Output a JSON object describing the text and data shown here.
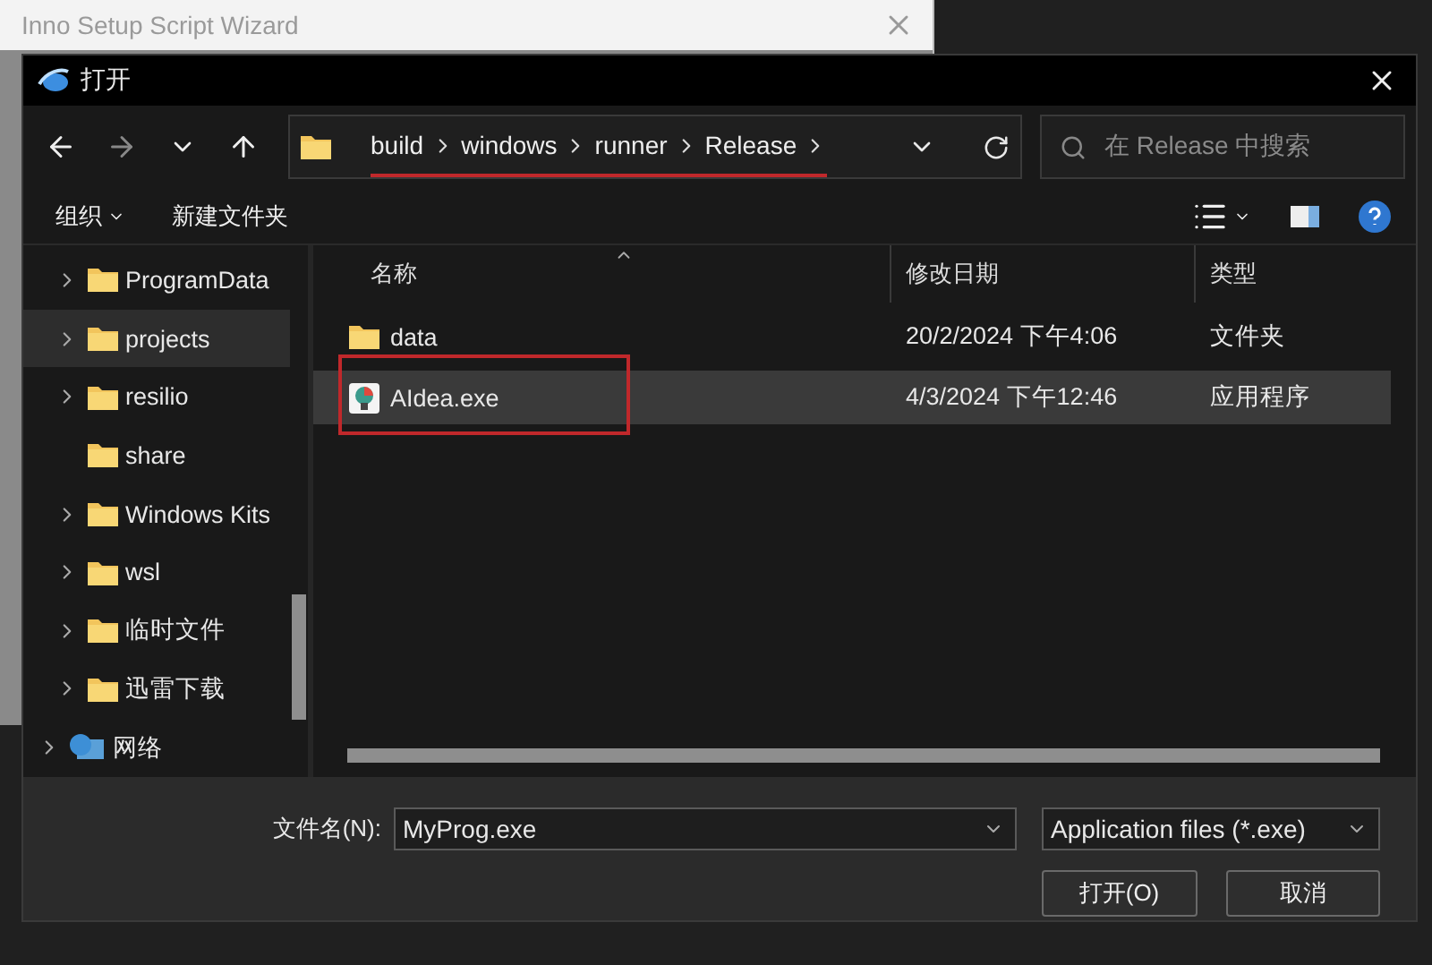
{
  "background_window": {
    "title": "Inno Setup Script Wizard"
  },
  "dialog": {
    "title": "打开"
  },
  "address": {
    "crumbs": [
      "build",
      "windows",
      "runner",
      "Release"
    ],
    "underlined": true
  },
  "search": {
    "placeholder": "在 Release 中搜索"
  },
  "commands": [
    {
      "label": "组织",
      "dropdown": true
    },
    {
      "label": "新建文件夹",
      "dropdown": false
    }
  ],
  "sidebar": {
    "items": [
      {
        "label": "ProgramData",
        "kind": "folder",
        "expandable": true,
        "selected": false
      },
      {
        "label": "projects",
        "kind": "folder",
        "expandable": true,
        "selected": true
      },
      {
        "label": "resilio",
        "kind": "folder",
        "expandable": true,
        "selected": false
      },
      {
        "label": "share",
        "kind": "folder",
        "expandable": false,
        "selected": false
      },
      {
        "label": "Windows Kits",
        "kind": "folder",
        "expandable": true,
        "selected": false
      },
      {
        "label": "wsl",
        "kind": "folder",
        "expandable": true,
        "selected": false
      },
      {
        "label": "临时文件",
        "kind": "folder",
        "expandable": true,
        "selected": false
      },
      {
        "label": "迅雷下载",
        "kind": "folder",
        "expandable": true,
        "selected": false
      },
      {
        "label": "网络",
        "kind": "network",
        "expandable": true,
        "selected": false
      }
    ]
  },
  "table": {
    "columns": [
      "名称",
      "修改日期",
      "类型"
    ],
    "rows": [
      {
        "name": "data",
        "kind": "folder",
        "modified": "20/2/2024 下午4:06",
        "type": "文件夹",
        "selected": false,
        "outlined": false
      },
      {
        "name": "AIdea.exe",
        "kind": "app",
        "modified": "4/3/2024 下午12:46",
        "type": "应用程序",
        "selected": true,
        "outlined": true
      }
    ]
  },
  "file_name": {
    "label": "文件名(N):",
    "value": "MyProg.exe"
  },
  "filter": {
    "value": "Application files (*.exe)"
  },
  "buttons": [
    "打开(O)",
    "取消"
  ]
}
